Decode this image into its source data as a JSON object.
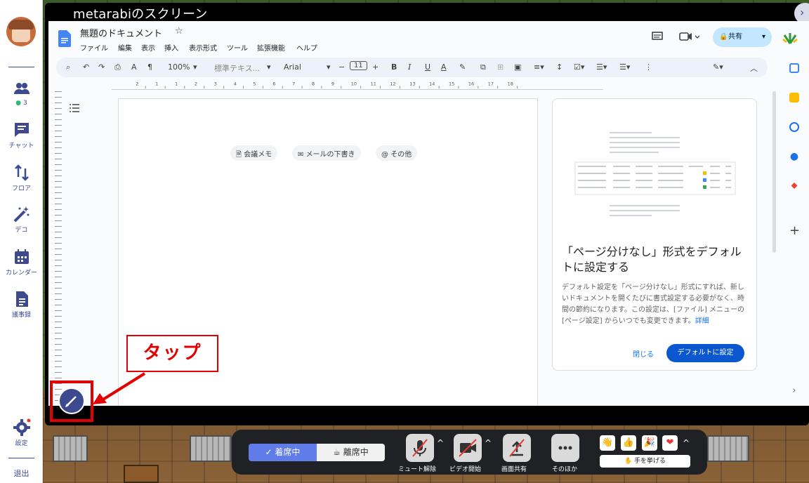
{
  "screen": {
    "title": "metarabiのスクリーン"
  },
  "sidebar": {
    "online_count": "3",
    "items": [
      {
        "label": "チャット"
      },
      {
        "label": "フロア"
      },
      {
        "label": "デコ"
      },
      {
        "label": "カレンダー"
      },
      {
        "label": "議事録"
      }
    ],
    "settings_label": "設定",
    "exit_label": "退出"
  },
  "docs": {
    "title": "無題のドキュメント",
    "menu": [
      "ファイル",
      "編集",
      "表示",
      "挿入",
      "表示形式",
      "ツール",
      "拡張機能",
      "ヘルプ"
    ],
    "toolbar": {
      "zoom": "100%",
      "style": "標準テキス...",
      "font": "Arial",
      "size": "11"
    },
    "share_label": "共有",
    "ruler": [
      "2",
      "1",
      "1",
      "2",
      "3",
      "4",
      "5",
      "6",
      "7",
      "8",
      "9",
      "10",
      "11",
      "12",
      "13",
      "14",
      "15",
      "16",
      "17",
      "18"
    ],
    "chips": [
      "会議メモ",
      "メールの下書き",
      "その他"
    ],
    "card": {
      "heading": "「ページ分けなし」形式をデフォルトに設定する",
      "body": "デフォルト設定を「ページ分けなし」形式にすれば、新しいドキュメントを開くたびに書式設定する必要がなく、時間の節約になります。この設定は、[ファイル] メニューの [ページ設定] からいつでも変更できます。",
      "link": "詳細",
      "close": "閉じる",
      "default_button": "デフォルトに設定"
    }
  },
  "annotation": {
    "tap": "タップ"
  },
  "bottombar": {
    "status_on": "着席中",
    "status_off": "離席中",
    "controls": [
      "ミュート解除",
      "ビデオ開始",
      "画面共有",
      "そのほか"
    ],
    "raise_hand": "手を挙げる",
    "emojis": [
      "👋",
      "👍",
      "🎉",
      "❤"
    ]
  },
  "colors": {
    "accent": "#3d4a8f",
    "annotation": "#e30000",
    "docs_blue": "#0b57d0"
  }
}
